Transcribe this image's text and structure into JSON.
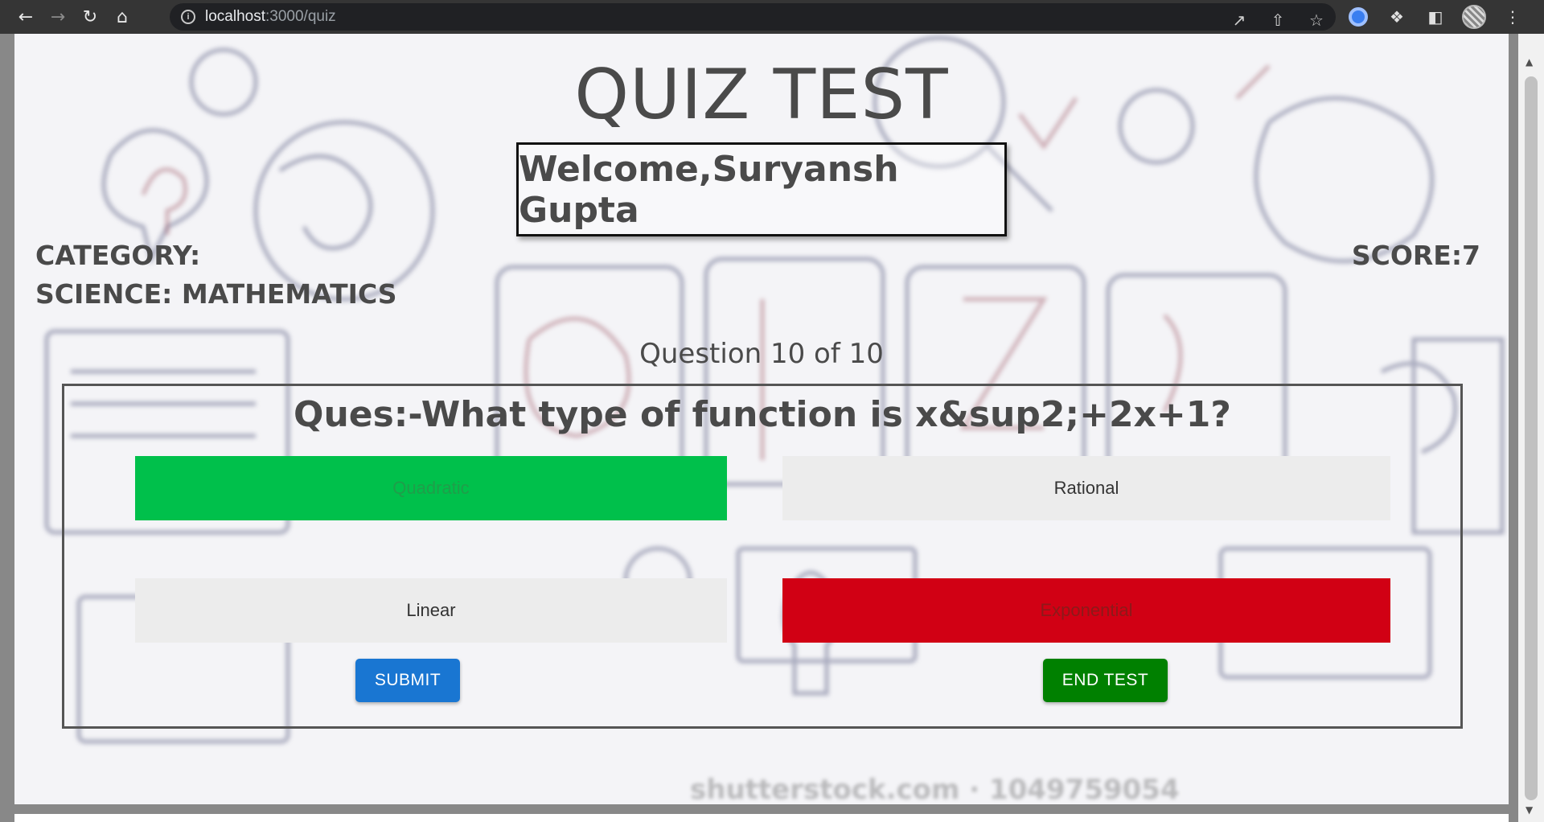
{
  "browser": {
    "url_host": "localhost",
    "url_path": ":3000/quiz"
  },
  "page": {
    "title": "QUIZ TEST",
    "welcome": "Welcome,Suryansh Gupta",
    "category_label": "CATEGORY:",
    "category_value": "SCIENCE: MATHEMATICS",
    "score": "SCORE:7",
    "counter": "Question 10 of 10",
    "question": "Ques:-What type of function is x&sup2;+2x+1?",
    "options": [
      {
        "label": "Quadratic",
        "state": "correct",
        "color": "#00c04b"
      },
      {
        "label": "Rational",
        "state": "neutral",
        "color": "#ececec"
      },
      {
        "label": "Linear",
        "state": "neutral",
        "color": "#ececec"
      },
      {
        "label": "Exponential",
        "state": "wrong",
        "color": "#d10014"
      }
    ],
    "submit_label": "SUBMIT",
    "end_label": "END TEST",
    "watermark": "shutterstock.com · 1049759054"
  },
  "colors": {
    "submit": "#1976d2",
    "end_test": "#008000",
    "text": "#4a4a4a"
  }
}
